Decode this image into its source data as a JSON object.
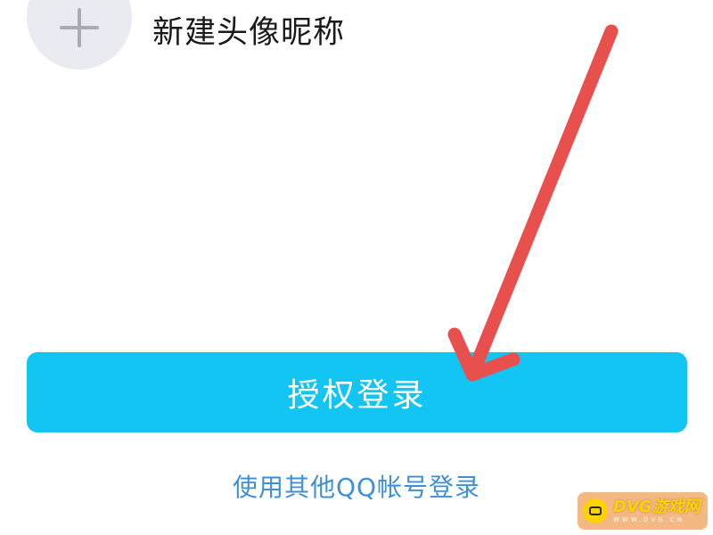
{
  "new_avatar": {
    "label": "新建头像昵称",
    "icon": "plus-icon"
  },
  "auth": {
    "button_label": "授权登录"
  },
  "other_login": {
    "link_text": "使用其他QQ帐号登录"
  },
  "annotation": {
    "arrow_color": "#e8504e"
  },
  "watermark": {
    "text": "DVG游戏网",
    "sub": "WWW.DVG.CN"
  },
  "colors": {
    "button": "#12c5f2",
    "link": "#3f8fd6",
    "avatar_bg": "#e9ebf1"
  }
}
